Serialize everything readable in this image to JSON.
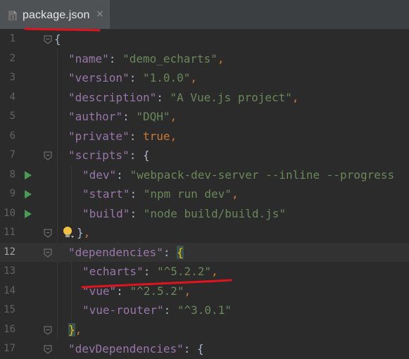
{
  "tab": {
    "filename": "package.json",
    "close_glyph": "×"
  },
  "lines": [
    {
      "n": "1",
      "tokens": [
        [
          "b",
          "{"
        ]
      ]
    },
    {
      "n": "2",
      "tokens": [
        [
          "k",
          "\"name\""
        ],
        [
          "b",
          ": "
        ],
        [
          "s",
          "\"demo_echarts\""
        ],
        [
          "p",
          ","
        ]
      ]
    },
    {
      "n": "3",
      "tokens": [
        [
          "k",
          "\"version\""
        ],
        [
          "b",
          ": "
        ],
        [
          "s",
          "\"1.0.0\""
        ],
        [
          "p",
          ","
        ]
      ]
    },
    {
      "n": "4",
      "tokens": [
        [
          "k",
          "\"description\""
        ],
        [
          "b",
          ": "
        ],
        [
          "s",
          "\"A Vue.js project\""
        ],
        [
          "p",
          ","
        ]
      ]
    },
    {
      "n": "5",
      "tokens": [
        [
          "k",
          "\"author\""
        ],
        [
          "b",
          ": "
        ],
        [
          "s",
          "\"DQH\""
        ],
        [
          "p",
          ","
        ]
      ]
    },
    {
      "n": "6",
      "tokens": [
        [
          "k",
          "\"private\""
        ],
        [
          "b",
          ": "
        ],
        [
          "p",
          "true"
        ],
        [
          "p",
          ","
        ]
      ]
    },
    {
      "n": "7",
      "tokens": [
        [
          "k",
          "\"scripts\""
        ],
        [
          "b",
          ": {"
        ]
      ]
    },
    {
      "n": "8",
      "tokens": [
        [
          "k",
          "\"dev\""
        ],
        [
          "b",
          ": "
        ],
        [
          "s",
          "\"webpack-dev-server --inline --progress"
        ]
      ]
    },
    {
      "n": "9",
      "tokens": [
        [
          "k",
          "\"start\""
        ],
        [
          "b",
          ": "
        ],
        [
          "s",
          "\"npm run dev\""
        ],
        [
          "p",
          ","
        ]
      ]
    },
    {
      "n": "10",
      "tokens": [
        [
          "k",
          "\"build\""
        ],
        [
          "b",
          ": "
        ],
        [
          "s",
          "\"node build/build.js\""
        ]
      ]
    },
    {
      "n": "11",
      "tokens": [
        [
          "b",
          "}"
        ],
        [
          "p",
          ","
        ]
      ]
    },
    {
      "n": "12",
      "tokens": [
        [
          "k",
          "\"dependencies\""
        ],
        [
          "b",
          ": "
        ],
        [
          "match",
          "{"
        ]
      ]
    },
    {
      "n": "13",
      "tokens": [
        [
          "k",
          "\"echarts\""
        ],
        [
          "b",
          ": "
        ],
        [
          "s",
          "\"^5.2.2\""
        ],
        [
          "p",
          ","
        ]
      ]
    },
    {
      "n": "14",
      "tokens": [
        [
          "k",
          "\"vue\""
        ],
        [
          "b",
          ": "
        ],
        [
          "s",
          "\"^2.5.2\""
        ],
        [
          "p",
          ","
        ]
      ]
    },
    {
      "n": "15",
      "tokens": [
        [
          "k",
          "\"vue-router\""
        ],
        [
          "b",
          ": "
        ],
        [
          "s",
          "\"^3.0.1\""
        ]
      ]
    },
    {
      "n": "16",
      "tokens": [
        [
          "match",
          "}"
        ],
        [
          "p",
          ","
        ]
      ]
    },
    {
      "n": "17",
      "tokens": [
        [
          "k",
          "\"devDependencies\""
        ],
        [
          "b",
          ": {"
        ]
      ]
    }
  ],
  "indent": [
    0,
    1,
    1,
    1,
    1,
    1,
    1,
    2,
    2,
    2,
    1,
    1,
    2,
    2,
    2,
    1,
    1
  ],
  "run_lines": [
    "8",
    "9",
    "10"
  ],
  "fold_lines": [
    "1",
    "7",
    "11",
    "12",
    "16",
    "17"
  ],
  "bulb_line": "11",
  "current_line": "12",
  "colors": {
    "annotation": "#e0141e",
    "run": "#499c54",
    "bulb": "#f0c040"
  }
}
